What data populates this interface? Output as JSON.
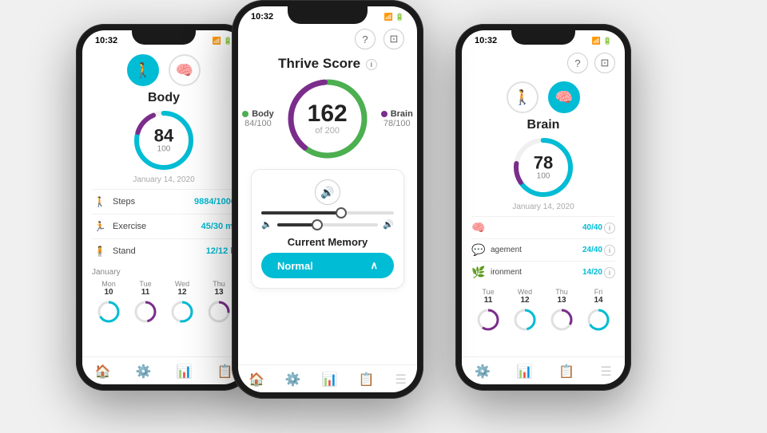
{
  "app": {
    "background": "#e8e8e8"
  },
  "left_phone": {
    "status_time": "10:32",
    "section": "Body",
    "score": "84",
    "score_denom": "100",
    "date": "January 14, 2020",
    "metrics": [
      {
        "icon": "🚶",
        "name": "Steps",
        "value": "9884/1000"
      },
      {
        "icon": "🏃",
        "name": "Exercise",
        "value": "45/30 mi"
      },
      {
        "icon": "🧍",
        "name": "Stand",
        "value": "12/12 h"
      }
    ],
    "calendar": {
      "month": "January",
      "days": [
        {
          "name": "Mon",
          "num": "10"
        },
        {
          "name": "Tue",
          "num": "11"
        },
        {
          "name": "Wed",
          "num": "12"
        },
        {
          "name": "Thu",
          "num": "13"
        }
      ]
    },
    "nav": [
      "🏠",
      "⚙️",
      "📊",
      "📋"
    ]
  },
  "center_phone": {
    "status_time": "10:32",
    "title": "Thrive Score",
    "score": "162",
    "score_denom": "of 200",
    "body_score": "84/100",
    "brain_score": "78/100",
    "body_dot_color": "#4caf50",
    "brain_dot_color": "#7b2d8b",
    "audio_section": {
      "slider1_fill": 60,
      "slider2_fill": 40
    },
    "memory_label": "Current Memory",
    "memory_btn": "Normal",
    "nav_items": [
      "🏠",
      "⚙️",
      "📊",
      "📋",
      "☰"
    ]
  },
  "right_phone": {
    "status_time": "10:32",
    "section": "Brain",
    "score": "78",
    "score_denom": "100",
    "date": "January 14, 2020",
    "metrics": [
      {
        "icon": "🧠",
        "name": "",
        "value": "40/40"
      },
      {
        "icon": "💬",
        "name": "agement",
        "value": "24/40"
      },
      {
        "icon": "🌿",
        "name": "ironment",
        "value": "14/20"
      }
    ],
    "calendar": {
      "days": [
        {
          "name": "Tue",
          "num": "11"
        },
        {
          "name": "Wed",
          "num": "12"
        },
        {
          "name": "Thu",
          "num": "13"
        },
        {
          "name": "Fri",
          "num": "14"
        }
      ]
    },
    "nav": [
      "⚙️",
      "📊",
      "📋",
      "☰"
    ]
  }
}
